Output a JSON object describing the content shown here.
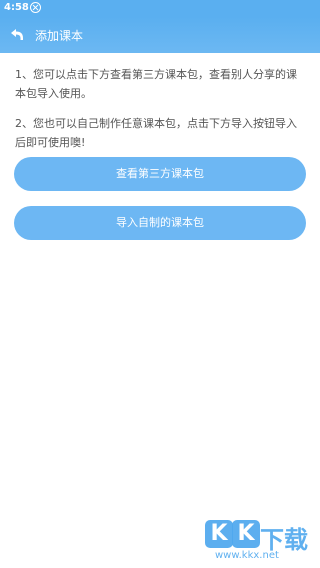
{
  "status": {
    "time": "4:58"
  },
  "header": {
    "title": "添加课本"
  },
  "info": {
    "line1": "1、您可以点击下方查看第三方课本包，查看别人分享的课本包导入使用。",
    "line2": "2、您也可以自己制作任意课本包，点击下方导入按钮导入后即可使用噢!"
  },
  "buttons": {
    "third_party": "查看第三方课本包",
    "import_own": "导入自制的课本包"
  },
  "watermark": {
    "k1": "K",
    "k2": "K",
    "cn": "下载",
    "url": "www.kkx.net"
  },
  "colors": {
    "accent": "#5aaff0",
    "button": "#6db7f3"
  }
}
